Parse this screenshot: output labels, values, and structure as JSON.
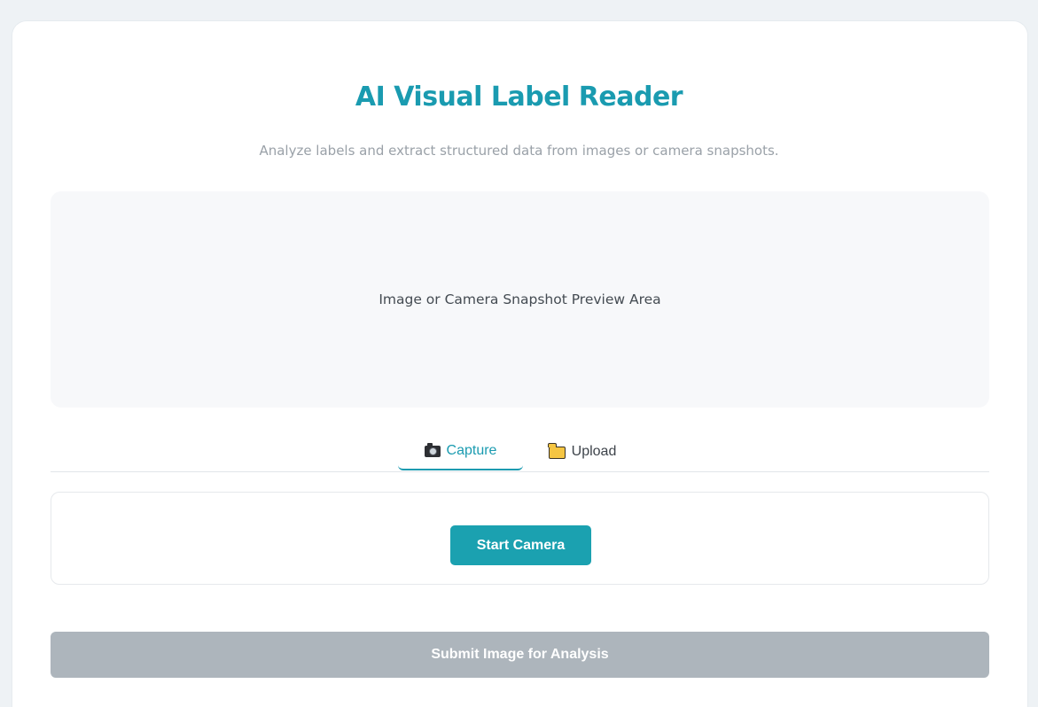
{
  "app": {
    "title": "AI Visual Label Reader",
    "subtitle": "Analyze labels and extract structured data from images or camera snapshots."
  },
  "preview": {
    "placeholder_text": "Image or Camera Snapshot Preview Area"
  },
  "tabs": [
    {
      "label": "Capture",
      "icon": "camera-icon",
      "active": true
    },
    {
      "label": "Upload",
      "icon": "folder-icon",
      "active": false
    }
  ],
  "capture_panel": {
    "start_camera_label": "Start Camera"
  },
  "submit": {
    "label": "Submit Image for Analysis",
    "enabled": false
  },
  "colors": {
    "accent": "#1a9bb0",
    "disabled_button": "#adb5bc",
    "background": "#eef2f5"
  }
}
